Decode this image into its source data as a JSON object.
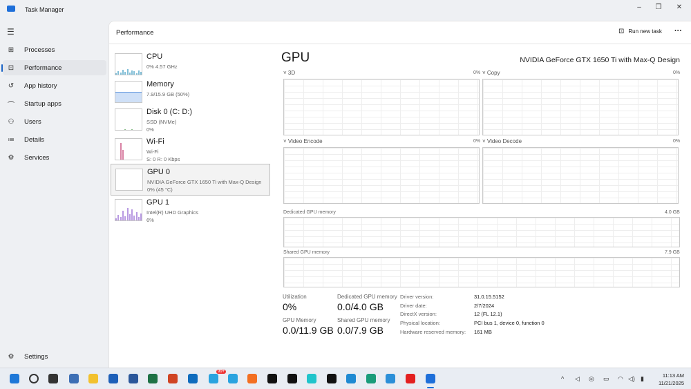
{
  "window": {
    "title": "Task Manager",
    "minimize": "–",
    "restore": "❐",
    "close": "✕"
  },
  "sidebar": {
    "menu_icon": "☰",
    "items": [
      {
        "label": "Processes",
        "icon": "processes-icon",
        "glyph": "⊞"
      },
      {
        "label": "Performance",
        "icon": "performance-icon",
        "glyph": "⊡"
      },
      {
        "label": "App history",
        "icon": "history-icon",
        "glyph": "↺"
      },
      {
        "label": "Startup apps",
        "icon": "speedometer-icon",
        "glyph": "⌒"
      },
      {
        "label": "Users",
        "icon": "users-icon",
        "glyph": "⚇"
      },
      {
        "label": "Details",
        "icon": "list-icon",
        "glyph": "≔"
      },
      {
        "label": "Services",
        "icon": "services-icon",
        "glyph": "⚙"
      }
    ],
    "settings": {
      "label": "Settings",
      "glyph": "⚙"
    }
  },
  "header": {
    "title": "Performance",
    "run_new_task": "Run new task",
    "more": "···"
  },
  "devices": [
    {
      "name": "CPU",
      "line1": "0%  4.57 GHz",
      "line2": "",
      "color": "#4aa3c6"
    },
    {
      "name": "Memory",
      "line1": "7.9/15.9 GB (50%)",
      "line2": "",
      "color": "#7aa7e0"
    },
    {
      "name": "Disk 0 (C: D:)",
      "line1": "SSD (NVMe)",
      "line2": "0%",
      "color": "#5aa05a"
    },
    {
      "name": "Wi-Fi",
      "line1": "Wi-Fi",
      "line2": "S: 0  R: 0 Kbps",
      "color": "#c94d7e"
    },
    {
      "name": "GPU 0",
      "line1": "NVIDIA GeForce GTX 1650 Ti with Max-Q Design",
      "line2": "0% (45 °C)",
      "color": "#8a63c9"
    },
    {
      "name": "GPU 1",
      "line1": "Intel(R) UHD Graphics",
      "line2": "6%",
      "color": "#9a6fd6"
    }
  ],
  "gpu": {
    "title": "GPU",
    "model": "NVIDIA GeForce GTX 1650 Ti with Max-Q Design",
    "engines": [
      {
        "label": "3D",
        "value": "0%"
      },
      {
        "label": "Copy",
        "value": "0%"
      },
      {
        "label": "Video Encode",
        "value": "0%"
      },
      {
        "label": "Video Decode",
        "value": "0%"
      }
    ],
    "dedicated": {
      "label": "Dedicated GPU memory",
      "max": "4.0 GB"
    },
    "shared": {
      "label": "Shared GPU memory",
      "max": "7.9 GB"
    },
    "stats": {
      "utilization_label": "Utilization",
      "utilization": "0%",
      "dedicated_label": "Dedicated GPU memory",
      "dedicated": "0.0/4.0 GB",
      "gpu_mem_label": "GPU Memory",
      "gpu_mem": "0.0/11.9 GB",
      "shared_label": "Shared GPU memory",
      "shared": "0.0/7.9 GB"
    },
    "props": [
      {
        "k": "Driver version:",
        "v": "31.0.15.5152"
      },
      {
        "k": "Driver date:",
        "v": "2/7/2024"
      },
      {
        "k": "DirectX version:",
        "v": "12 (FL 12.1)"
      },
      {
        "k": "Physical location:",
        "v": "PCI bus 1, device 0, function 0"
      },
      {
        "k": "Hardware reserved memory:",
        "v": "161 MB"
      }
    ]
  },
  "taskbar": {
    "time": "11:13 AM",
    "date": "11/21/2025",
    "badge": "99+",
    "apps": [
      "start",
      "search",
      "task-view",
      "settings",
      "file-explorer",
      "store",
      "word",
      "excel",
      "powerpoint",
      "outlook",
      "telegram-alt",
      "telegram",
      "app-orange",
      "figma",
      "notion",
      "canva",
      "capcut",
      "vscode",
      "edge",
      "edge-dev",
      "youtube",
      "task-manager"
    ],
    "colors": [
      "#1e78d8",
      "#333",
      "#333",
      "#3d6fb5",
      "#f2c12e",
      "#1d5fb8",
      "#2b579a",
      "#1e7145",
      "#d04423",
      "#0f6cbd",
      "#2aa3df",
      "#2aa3df",
      "#f36f21",
      "#111",
      "#111",
      "#20c4cb",
      "#111",
      "#1f8ad2",
      "#1a9c7a",
      "#2b8fd8",
      "#e32020",
      "#1e6fd9"
    ]
  }
}
